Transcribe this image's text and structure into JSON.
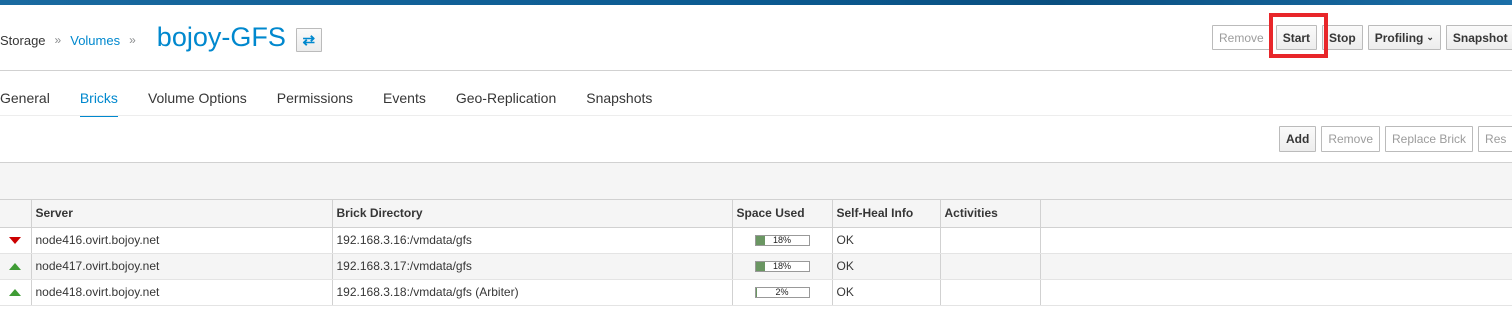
{
  "breadcrumb": {
    "root": "Storage",
    "sep": "»",
    "section": "Volumes",
    "sep2": "»"
  },
  "page_title": "bojoy-GFS",
  "swap_icon_glyph": "⇄",
  "actions": [
    {
      "label": "Remove",
      "disabled": true
    },
    {
      "label": "Start",
      "disabled": false
    },
    {
      "label": "Stop",
      "disabled": false
    },
    {
      "label": "Profiling",
      "disabled": false,
      "dropdown": true,
      "caret": "⌄"
    },
    {
      "label": "Snapshot",
      "disabled": false
    }
  ],
  "tabs": [
    "General",
    "Bricks",
    "Volume Options",
    "Permissions",
    "Events",
    "Geo-Replication",
    "Snapshots"
  ],
  "active_tab": "Bricks",
  "brick_toolbar": [
    {
      "label": "Add",
      "disabled": false
    },
    {
      "label": "Remove",
      "disabled": true
    },
    {
      "label": "Replace Brick",
      "disabled": true
    },
    {
      "label": "Res",
      "disabled": true
    }
  ],
  "table": {
    "headers": [
      "",
      "Server",
      "Brick Directory",
      "Space Used",
      "Self-Heal Info",
      "Activities",
      ""
    ],
    "rows": [
      {
        "status": "down",
        "server": "node416.ovirt.bojoy.net",
        "brick": "192.168.3.16:/vmdata/gfs",
        "space": "18%",
        "space_pct": 18,
        "heal": "OK",
        "activities": ""
      },
      {
        "status": "up",
        "server": "node417.ovirt.bojoy.net",
        "brick": "192.168.3.17:/vmdata/gfs",
        "space": "18%",
        "space_pct": 18,
        "heal": "OK",
        "activities": ""
      },
      {
        "status": "up",
        "server": "node418.ovirt.bojoy.net",
        "brick": "192.168.3.18:/vmdata/gfs (Arbiter)",
        "space": "2%",
        "space_pct": 2,
        "heal": "OK",
        "activities": ""
      }
    ]
  },
  "colors": {
    "accent": "#0088ce",
    "status_up": "#3f9c35",
    "status_down": "#cc0000",
    "highlight": "#e8262a"
  }
}
